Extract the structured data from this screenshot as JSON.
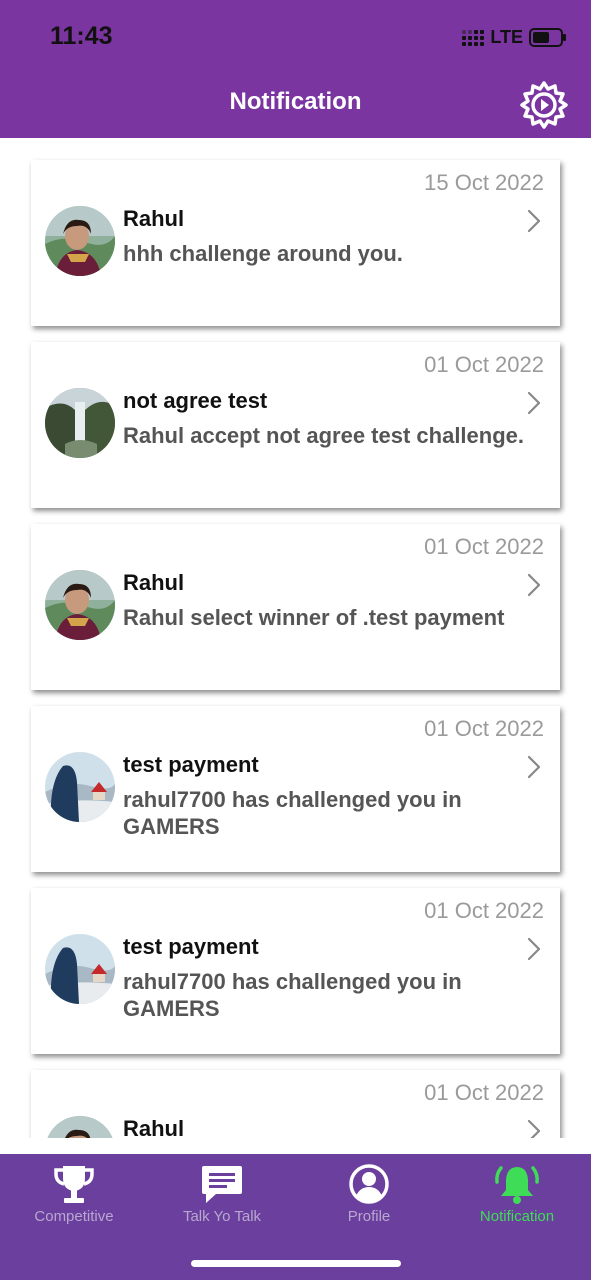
{
  "status_bar": {
    "time": "11:43",
    "network": "LTE"
  },
  "header": {
    "title": "Notification",
    "settings_icon": "gear-icon"
  },
  "notifications": [
    {
      "date": "15 Oct 2022",
      "name": "Rahul",
      "message": "hhh challenge around you.",
      "avatar": "avatar-woman"
    },
    {
      "date": "01 Oct 2022",
      "name": "not agree test",
      "message": "Rahul accept not agree test challenge.",
      "avatar": "avatar-waterfall"
    },
    {
      "date": "01 Oct 2022",
      "name": "Rahul",
      "message": "Rahul select winner of .test payment",
      "avatar": "avatar-woman"
    },
    {
      "date": "01 Oct 2022",
      "name": "test payment",
      "message": "rahul7700 has challenged you in GAMERS",
      "avatar": "avatar-mountain"
    },
    {
      "date": "01 Oct 2022",
      "name": "test payment",
      "message": "rahul7700 has challenged you in GAMERS",
      "avatar": "avatar-mountain"
    },
    {
      "date": "01 Oct 2022",
      "name": "Rahul",
      "message": "",
      "avatar": "avatar-woman"
    }
  ],
  "tabs": [
    {
      "label": "Competitive",
      "icon": "trophy-icon",
      "active": false
    },
    {
      "label": "Talk Yo Talk",
      "icon": "chat-icon",
      "active": false
    },
    {
      "label": "Profile",
      "icon": "profile-icon",
      "active": false
    },
    {
      "label": "Notification",
      "icon": "bell-icon",
      "active": true
    }
  ],
  "colors": {
    "header": "#7b35a0",
    "tabbar": "#6a3f9e",
    "active_tab": "#3fdc57",
    "inactive_tab": "#b9a7cf"
  }
}
